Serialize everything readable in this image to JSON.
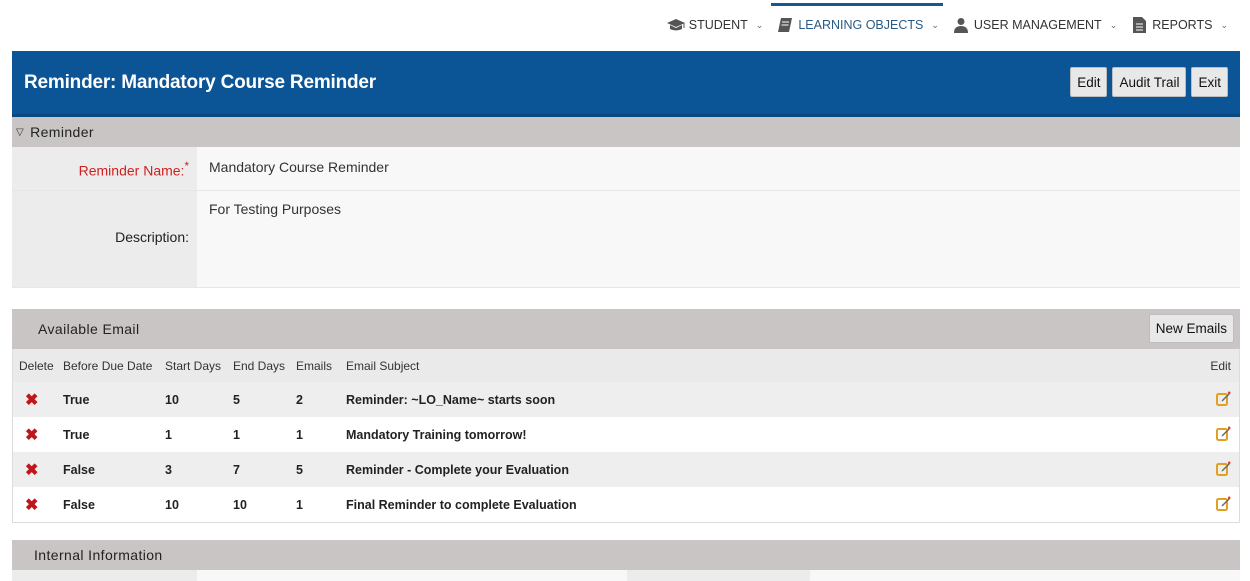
{
  "nav": {
    "items": [
      {
        "label": "STUDENT",
        "icon": "graduation-cap-icon"
      },
      {
        "label": "LEARNING OBJECTS",
        "icon": "book-icon",
        "active": true
      },
      {
        "label": "USER MANAGEMENT",
        "icon": "user-icon"
      },
      {
        "label": "REPORTS",
        "icon": "document-icon"
      }
    ],
    "active_color": "#17598f"
  },
  "header": {
    "title": "Reminder: Mandatory Course Reminder",
    "buttons": {
      "edit": "Edit",
      "audit_trail": "Audit Trail",
      "exit": "Exit"
    },
    "background": "#0b5597"
  },
  "reminder_section": {
    "title": "Reminder",
    "name_label": "Reminder Name:",
    "required_mark": "*",
    "name_value": "Mandatory Course Reminder",
    "description_label": "Description:",
    "description_value": "For Testing Purposes"
  },
  "email_section": {
    "title": "Available Email",
    "new_button": "New Emails",
    "columns": {
      "delete": "Delete",
      "before_due_date": "Before Due Date",
      "start_days": "Start Days",
      "end_days": "End Days",
      "emails": "Emails",
      "subject": "Email Subject",
      "edit": "Edit"
    },
    "rows": [
      {
        "before_due_date": "True",
        "start_days": "10",
        "end_days": "5",
        "emails": "2",
        "subject": "Reminder: ~LO_Name~ starts soon"
      },
      {
        "before_due_date": "True",
        "start_days": "1",
        "end_days": "1",
        "emails": "1",
        "subject": "Mandatory Training tomorrow!"
      },
      {
        "before_due_date": "False",
        "start_days": "3",
        "end_days": "7",
        "emails": "5",
        "subject": "Reminder - Complete your Evaluation"
      },
      {
        "before_due_date": "False",
        "start_days": "10",
        "end_days": "10",
        "emails": "1",
        "subject": "Final Reminder to complete Evaluation"
      }
    ],
    "delete_color": "#c0161b"
  },
  "internal_section": {
    "title": "Internal Information"
  }
}
